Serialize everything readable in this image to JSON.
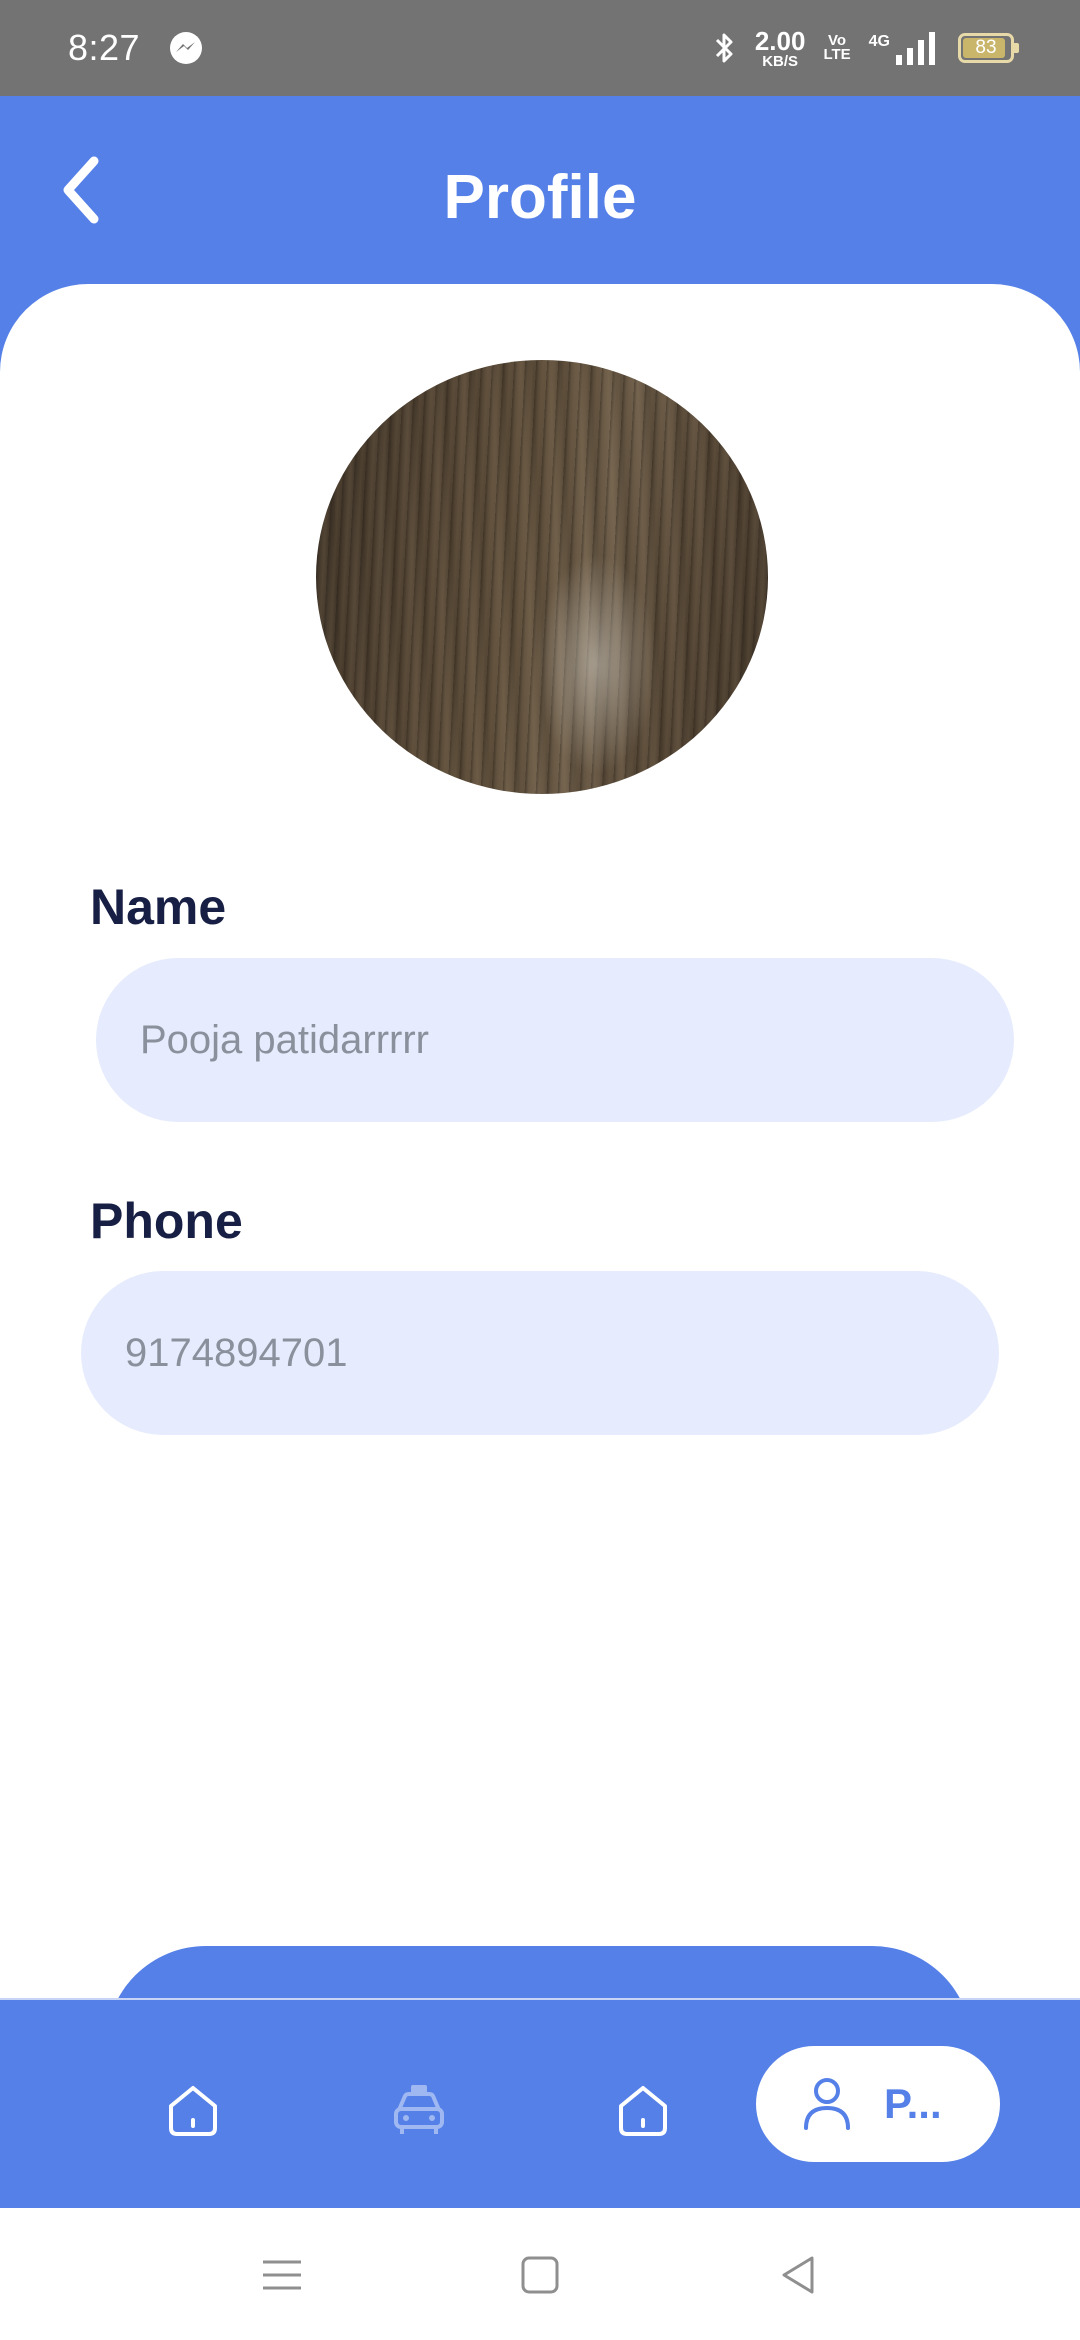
{
  "status_bar": {
    "time": "8:27",
    "network_speed_value": "2.00",
    "network_speed_unit": "KB/S",
    "volte_top": "Vo",
    "volte_bottom": "LTE",
    "signal_type": "4G",
    "battery_level": "83",
    "icons": [
      "messenger-icon",
      "bluetooth-icon",
      "signal-icon",
      "battery-icon"
    ]
  },
  "header": {
    "title": "Profile",
    "back_icon": "chevron-left-icon"
  },
  "profile": {
    "avatar_icon": "profile-photo"
  },
  "form": {
    "name_label": "Name",
    "name_value": "Pooja patidarrrrr",
    "phone_label": "Phone",
    "phone_value": "9174894701"
  },
  "bottom_nav": {
    "items": [
      {
        "icon": "home-icon"
      },
      {
        "icon": "car-icon"
      },
      {
        "icon": "home-icon"
      },
      {
        "icon": "user-icon",
        "label": "P...",
        "active": true
      }
    ]
  },
  "system_nav": {
    "icons": [
      "menu-icon",
      "square-home-icon",
      "triangle-back-icon"
    ]
  },
  "colors": {
    "primary": "#5580e8",
    "field_bg": "#e6ecfd",
    "label_text": "#172044",
    "status_bar": "#737373"
  }
}
